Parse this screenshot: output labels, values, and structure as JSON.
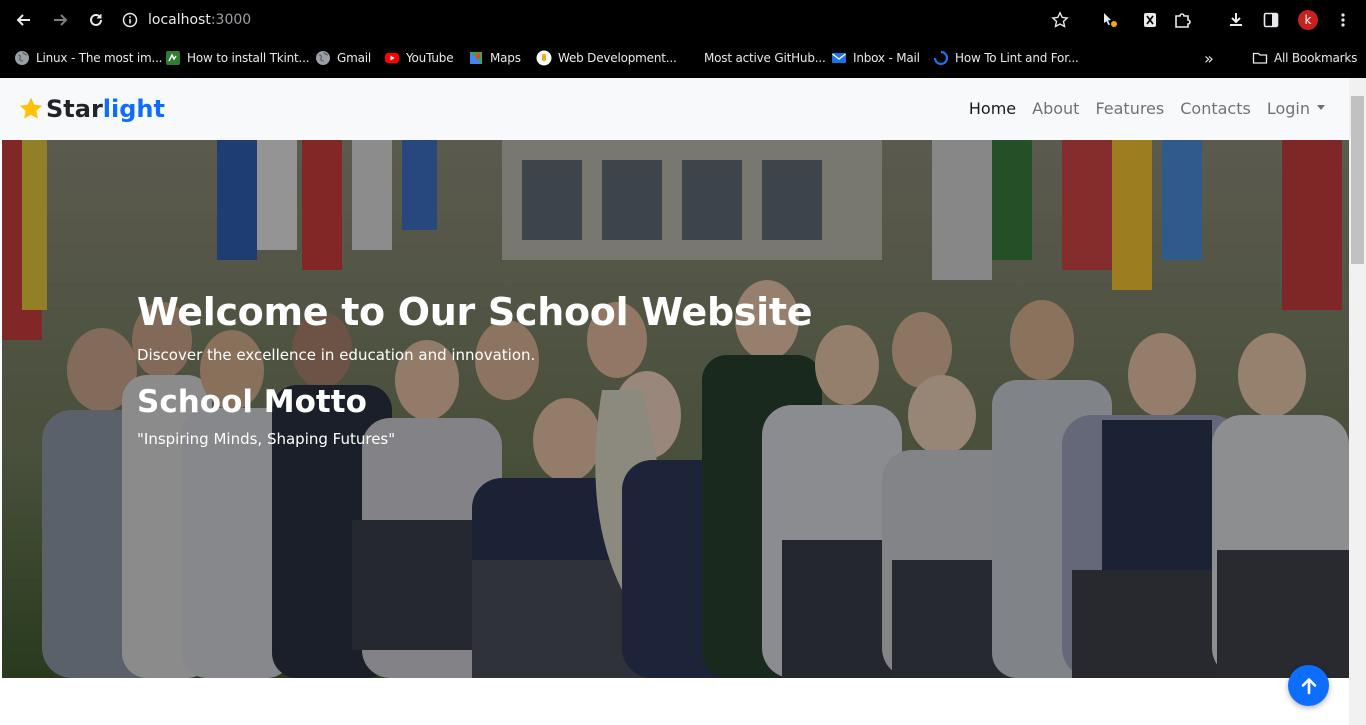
{
  "browser": {
    "url_host": "localhost",
    "url_port": ":3000",
    "avatar_letter": "k",
    "bookmarks": [
      {
        "label": "Linux - The most im...",
        "icon": "globe-icon"
      },
      {
        "label": "How to install Tkint...",
        "icon": "green-doc-icon"
      },
      {
        "label": "Gmail",
        "icon": "globe-icon"
      },
      {
        "label": "YouTube",
        "icon": "youtube-icon"
      },
      {
        "label": "Maps",
        "icon": "maps-icon"
      },
      {
        "label": "Web Development...",
        "icon": "web-dev-icon"
      },
      {
        "label": "Most active GitHub...",
        "icon": "none"
      },
      {
        "label": "Inbox - Mail",
        "icon": "mail-icon"
      },
      {
        "label": "How To Lint and For...",
        "icon": "loading-icon"
      }
    ],
    "all_bookmarks_label": "All Bookmarks",
    "overflow_label": "»"
  },
  "site": {
    "brand_star_word": "Star",
    "brand_light_word": "light",
    "nav": {
      "home": "Home",
      "about": "About",
      "features": "Features",
      "contacts": "Contacts",
      "login": "Login"
    },
    "hero": {
      "title": "Welcome to Our School Website",
      "subtitle": "Discover the excellence in education and innovation.",
      "motto_title": "School Motto",
      "motto": "\"Inspiring Minds, Shaping Futures\""
    }
  },
  "colors": {
    "brand_blue": "#0d6efd",
    "brand_star": "#ffc107",
    "navbar_bg": "#f8f9fa"
  }
}
